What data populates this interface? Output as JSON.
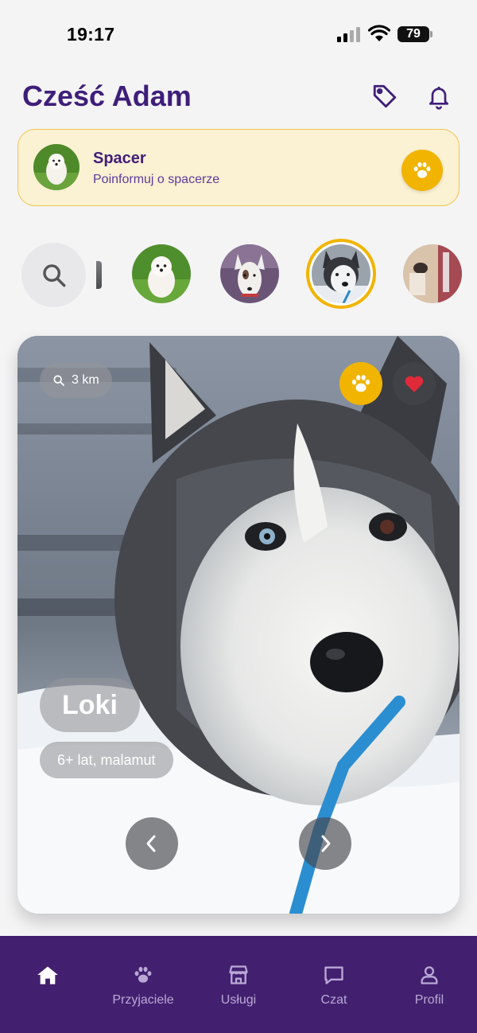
{
  "status": {
    "time": "19:17",
    "battery": "79"
  },
  "header": {
    "greeting": "Cześć Adam"
  },
  "walk": {
    "title": "Spacer",
    "subtitle": "Poinformuj o spacerze"
  },
  "pet": {
    "distance": "3 km",
    "name": "Loki",
    "info": "6+ lat, malamut"
  },
  "nav": {
    "items": [
      {
        "label": "",
        "icon": "home-icon",
        "active": true
      },
      {
        "label": "Przyjaciele",
        "icon": "paw-icon"
      },
      {
        "label": "Usługi",
        "icon": "store-icon"
      },
      {
        "label": "Czat",
        "icon": "chat-icon"
      },
      {
        "label": "Profil",
        "icon": "person-icon"
      }
    ]
  },
  "colors": {
    "brand": "#42206f",
    "accent": "#f1b400",
    "title": "#3f1e7a",
    "banner": "#fbf1d3"
  }
}
